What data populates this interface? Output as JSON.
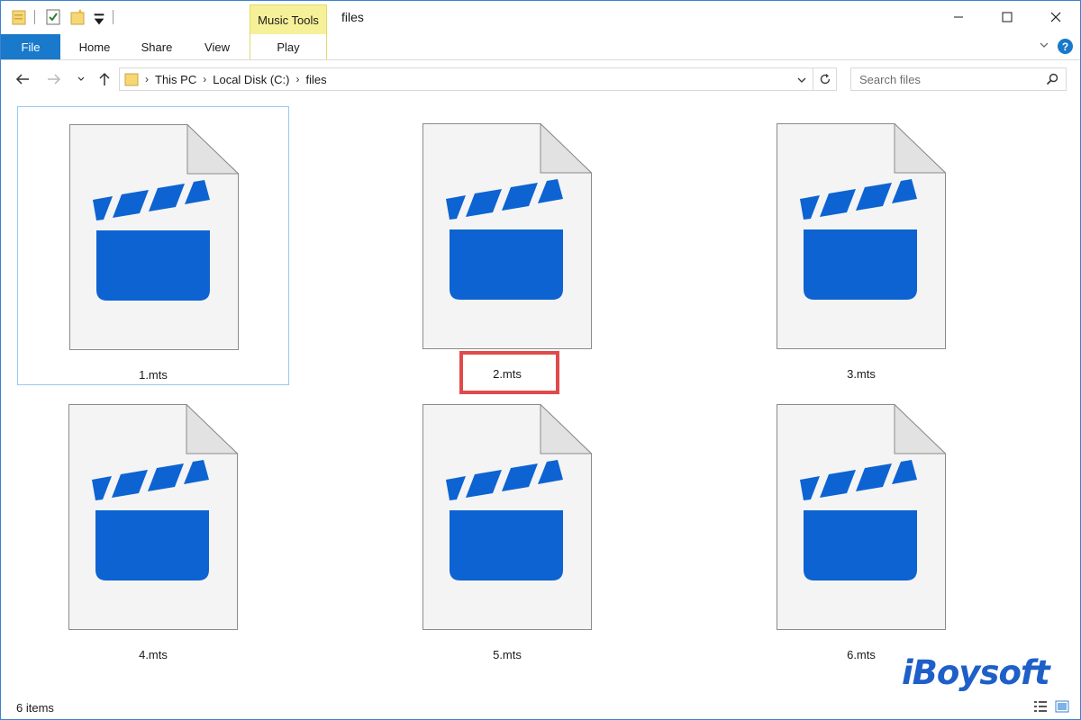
{
  "window": {
    "title": "files",
    "context_tab_group": "Music Tools",
    "controls": [
      "minimize",
      "maximize",
      "close"
    ]
  },
  "quick_access": {
    "icons": [
      "folder-properties-icon",
      "checkmark-icon",
      "new-folder-icon",
      "customize-dropdown-icon"
    ]
  },
  "ribbon": {
    "tabs": [
      {
        "label": "File"
      },
      {
        "label": "Home"
      },
      {
        "label": "Share"
      },
      {
        "label": "View"
      },
      {
        "label": "Play"
      }
    ]
  },
  "address": {
    "breadcrumbs": [
      "This PC",
      "Local Disk (C:)",
      "files"
    ]
  },
  "search": {
    "placeholder": "Search files"
  },
  "files": [
    {
      "name": "1.mts",
      "selected": true
    },
    {
      "name": "2.mts",
      "highlighted": true
    },
    {
      "name": "3.mts"
    },
    {
      "name": "4.mts"
    },
    {
      "name": "5.mts"
    },
    {
      "name": "6.mts"
    }
  ],
  "status": {
    "item_count": "6 items"
  },
  "watermark": "iBoysoft",
  "colors": {
    "accent": "#1979ca",
    "file_icon_blue": "#0d63d1",
    "context_tab": "#f6f198",
    "highlight_red": "#e04a4a",
    "selection_border": "#99c9ef"
  }
}
